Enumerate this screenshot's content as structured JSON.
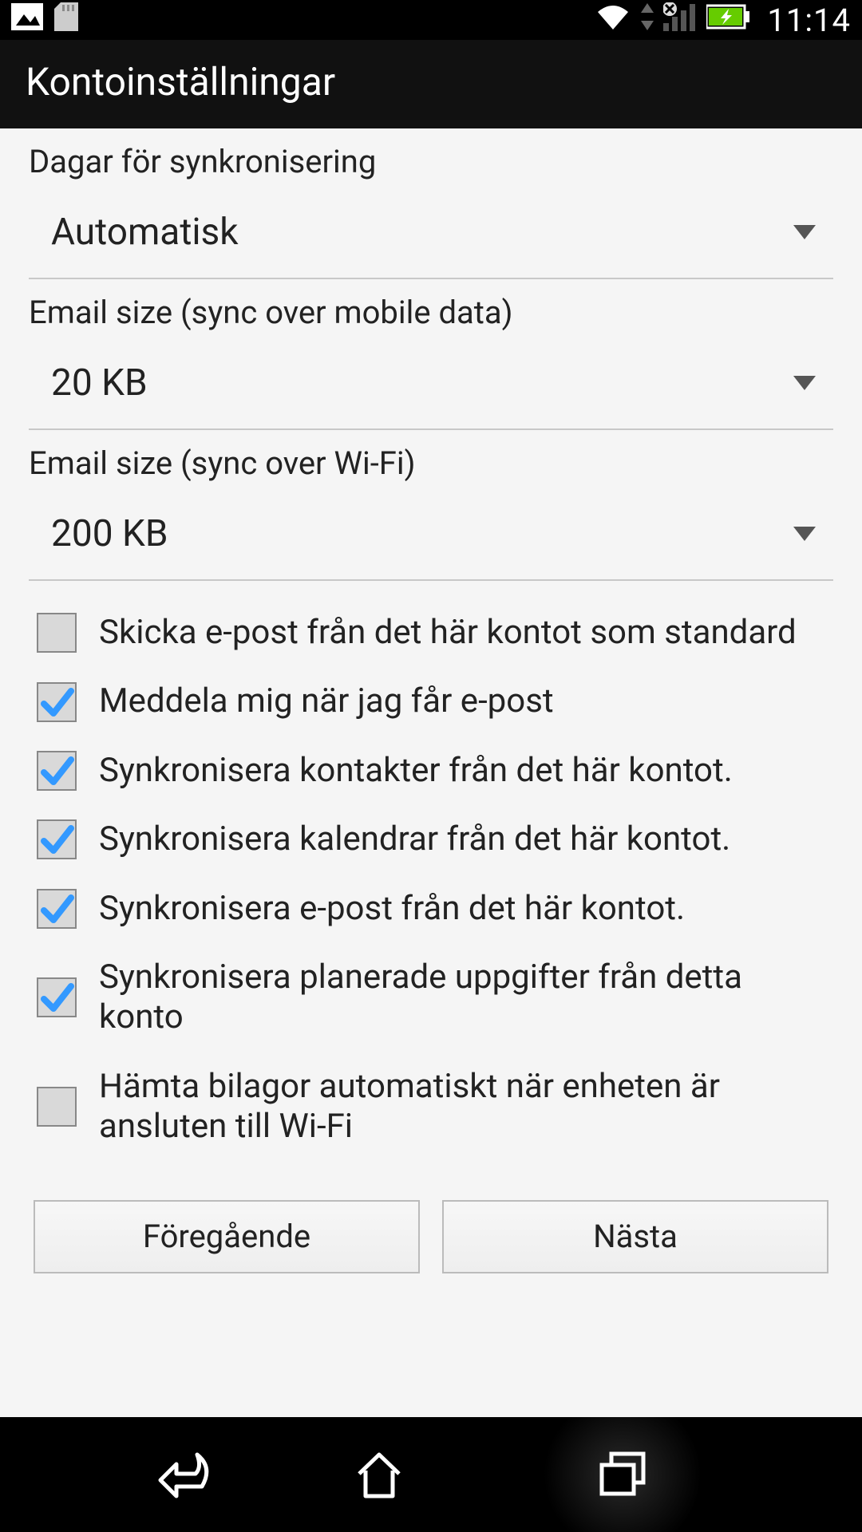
{
  "status": {
    "clock": "11:14"
  },
  "header": {
    "title": "Kontoinställningar"
  },
  "settings": {
    "sync_days": {
      "label": "Dagar för synkronisering",
      "value": "Automatisk"
    },
    "email_size_mobile": {
      "label": "Email size (sync over mobile data)",
      "value": "20 KB"
    },
    "email_size_wifi": {
      "label": "Email size (sync over Wi-Fi)",
      "value": "200 KB"
    }
  },
  "checkboxes": [
    {
      "label": "Skicka e-post från det här kontot som standard",
      "checked": false
    },
    {
      "label": "Meddela mig när jag får e-post",
      "checked": true
    },
    {
      "label": "Synkronisera kontakter från det här kontot.",
      "checked": true
    },
    {
      "label": "Synkronisera kalendrar från det här kontot.",
      "checked": true
    },
    {
      "label": "Synkronisera e-post från det här kontot.",
      "checked": true
    },
    {
      "label": "Synkronisera planerade uppgifter från detta konto",
      "checked": true
    },
    {
      "label": "Hämta bilagor automatiskt när enheten är ansluten till Wi-Fi",
      "checked": false
    }
  ],
  "buttons": {
    "prev": "Föregående",
    "next": "Nästa"
  }
}
